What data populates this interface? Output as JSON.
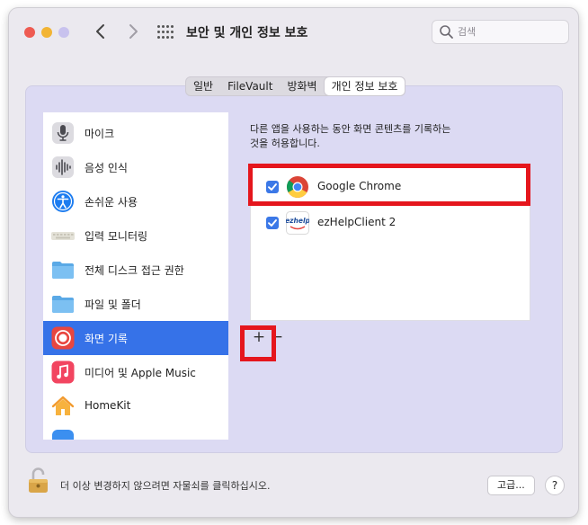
{
  "window": {
    "title": "보안 및 개인 정보 보호",
    "back_icon": "chevron-left-icon",
    "forward_icon": "chevron-right-icon",
    "grid_icon": "grid-icon"
  },
  "search": {
    "placeholder": "검색",
    "value": ""
  },
  "tabs": [
    {
      "label": "일반"
    },
    {
      "label": "FileVault"
    },
    {
      "label": "방화벽"
    },
    {
      "label": "개인 정보 보호",
      "active": true
    }
  ],
  "sidebar": {
    "items": [
      {
        "label": "마이크",
        "icon": "microphone-icon"
      },
      {
        "label": "음성 인식",
        "icon": "waveform-icon"
      },
      {
        "label": "손쉬운 사용",
        "icon": "accessibility-icon"
      },
      {
        "label": "입력 모니터링",
        "icon": "keyboard-icon"
      },
      {
        "label": "전체 디스크 접근 권한",
        "icon": "folder-icon"
      },
      {
        "label": "파일 및 폴더",
        "icon": "folder-icon"
      },
      {
        "label": "화면 기록",
        "icon": "screen-record-icon",
        "selected": true
      },
      {
        "label": "미디어 및 Apple Music",
        "icon": "music-icon"
      },
      {
        "label": "HomeKit",
        "icon": "home-icon"
      }
    ]
  },
  "main": {
    "description_line1": "다른 앱을 사용하는 동안 화면 콘텐츠를 기록하는",
    "description_line2": "것을 허용합니다.",
    "apps": [
      {
        "name": "Google Chrome",
        "checked": true,
        "icon": "chrome-icon"
      },
      {
        "name": "ezHelpClient 2",
        "checked": true,
        "icon": "ezhelp-icon"
      }
    ],
    "ezhelp_logo_text": "ezhelp",
    "add_label": "+",
    "remove_label": "−"
  },
  "footer": {
    "lock_text": "더 이상 변경하지 않으려면 자물쇠를 클릭하십시오.",
    "advanced_label": "고급...",
    "help_label": "?"
  },
  "colors": {
    "selection": "#3672e8",
    "highlight": "#e5161d",
    "panel": "#dcdaf3",
    "checkbox": "#3b78e7"
  }
}
